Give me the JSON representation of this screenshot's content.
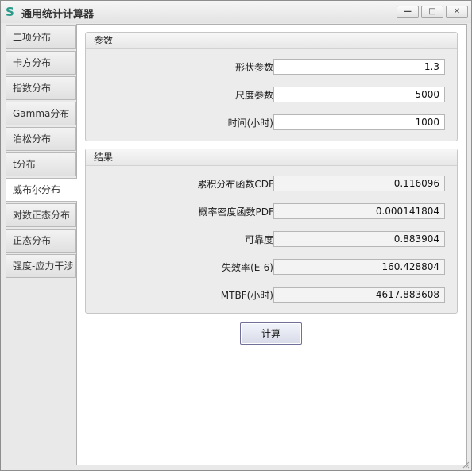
{
  "window": {
    "title": "通用统计计算器",
    "app_icon": "S",
    "minimize_glyph": "—",
    "maximize_glyph": "□",
    "close_glyph": "✕"
  },
  "sidebar": {
    "items": [
      {
        "label": "二项分布"
      },
      {
        "label": "卡方分布"
      },
      {
        "label": "指数分布"
      },
      {
        "label": "Gamma分布"
      },
      {
        "label": "泊松分布"
      },
      {
        "label": "t分布"
      },
      {
        "label": "威布尔分布",
        "active": true
      },
      {
        "label": "对数正态分布"
      },
      {
        "label": "正态分布"
      },
      {
        "label": "强度-应力干涉"
      }
    ]
  },
  "params": {
    "header": "参数",
    "shape_label": "形状参数:",
    "shape_value": "1.3",
    "scale_label": "尺度参数:",
    "scale_value": "5000",
    "time_label": "时间(小时):",
    "time_value": "1000"
  },
  "results": {
    "header": "结果",
    "cdf_label": "累积分布函数CDF:",
    "cdf_value": "0.116096",
    "pdf_label": "概率密度函数PDF:",
    "pdf_value": "0.000141804",
    "rel_label": "可靠度:",
    "rel_value": "0.883904",
    "fail_label": "失效率(E-6):",
    "fail_value": "160.428804",
    "mtbf_label": "MTBF(小时):",
    "mtbf_value": "4617.883608"
  },
  "actions": {
    "calculate_label": "计算"
  }
}
